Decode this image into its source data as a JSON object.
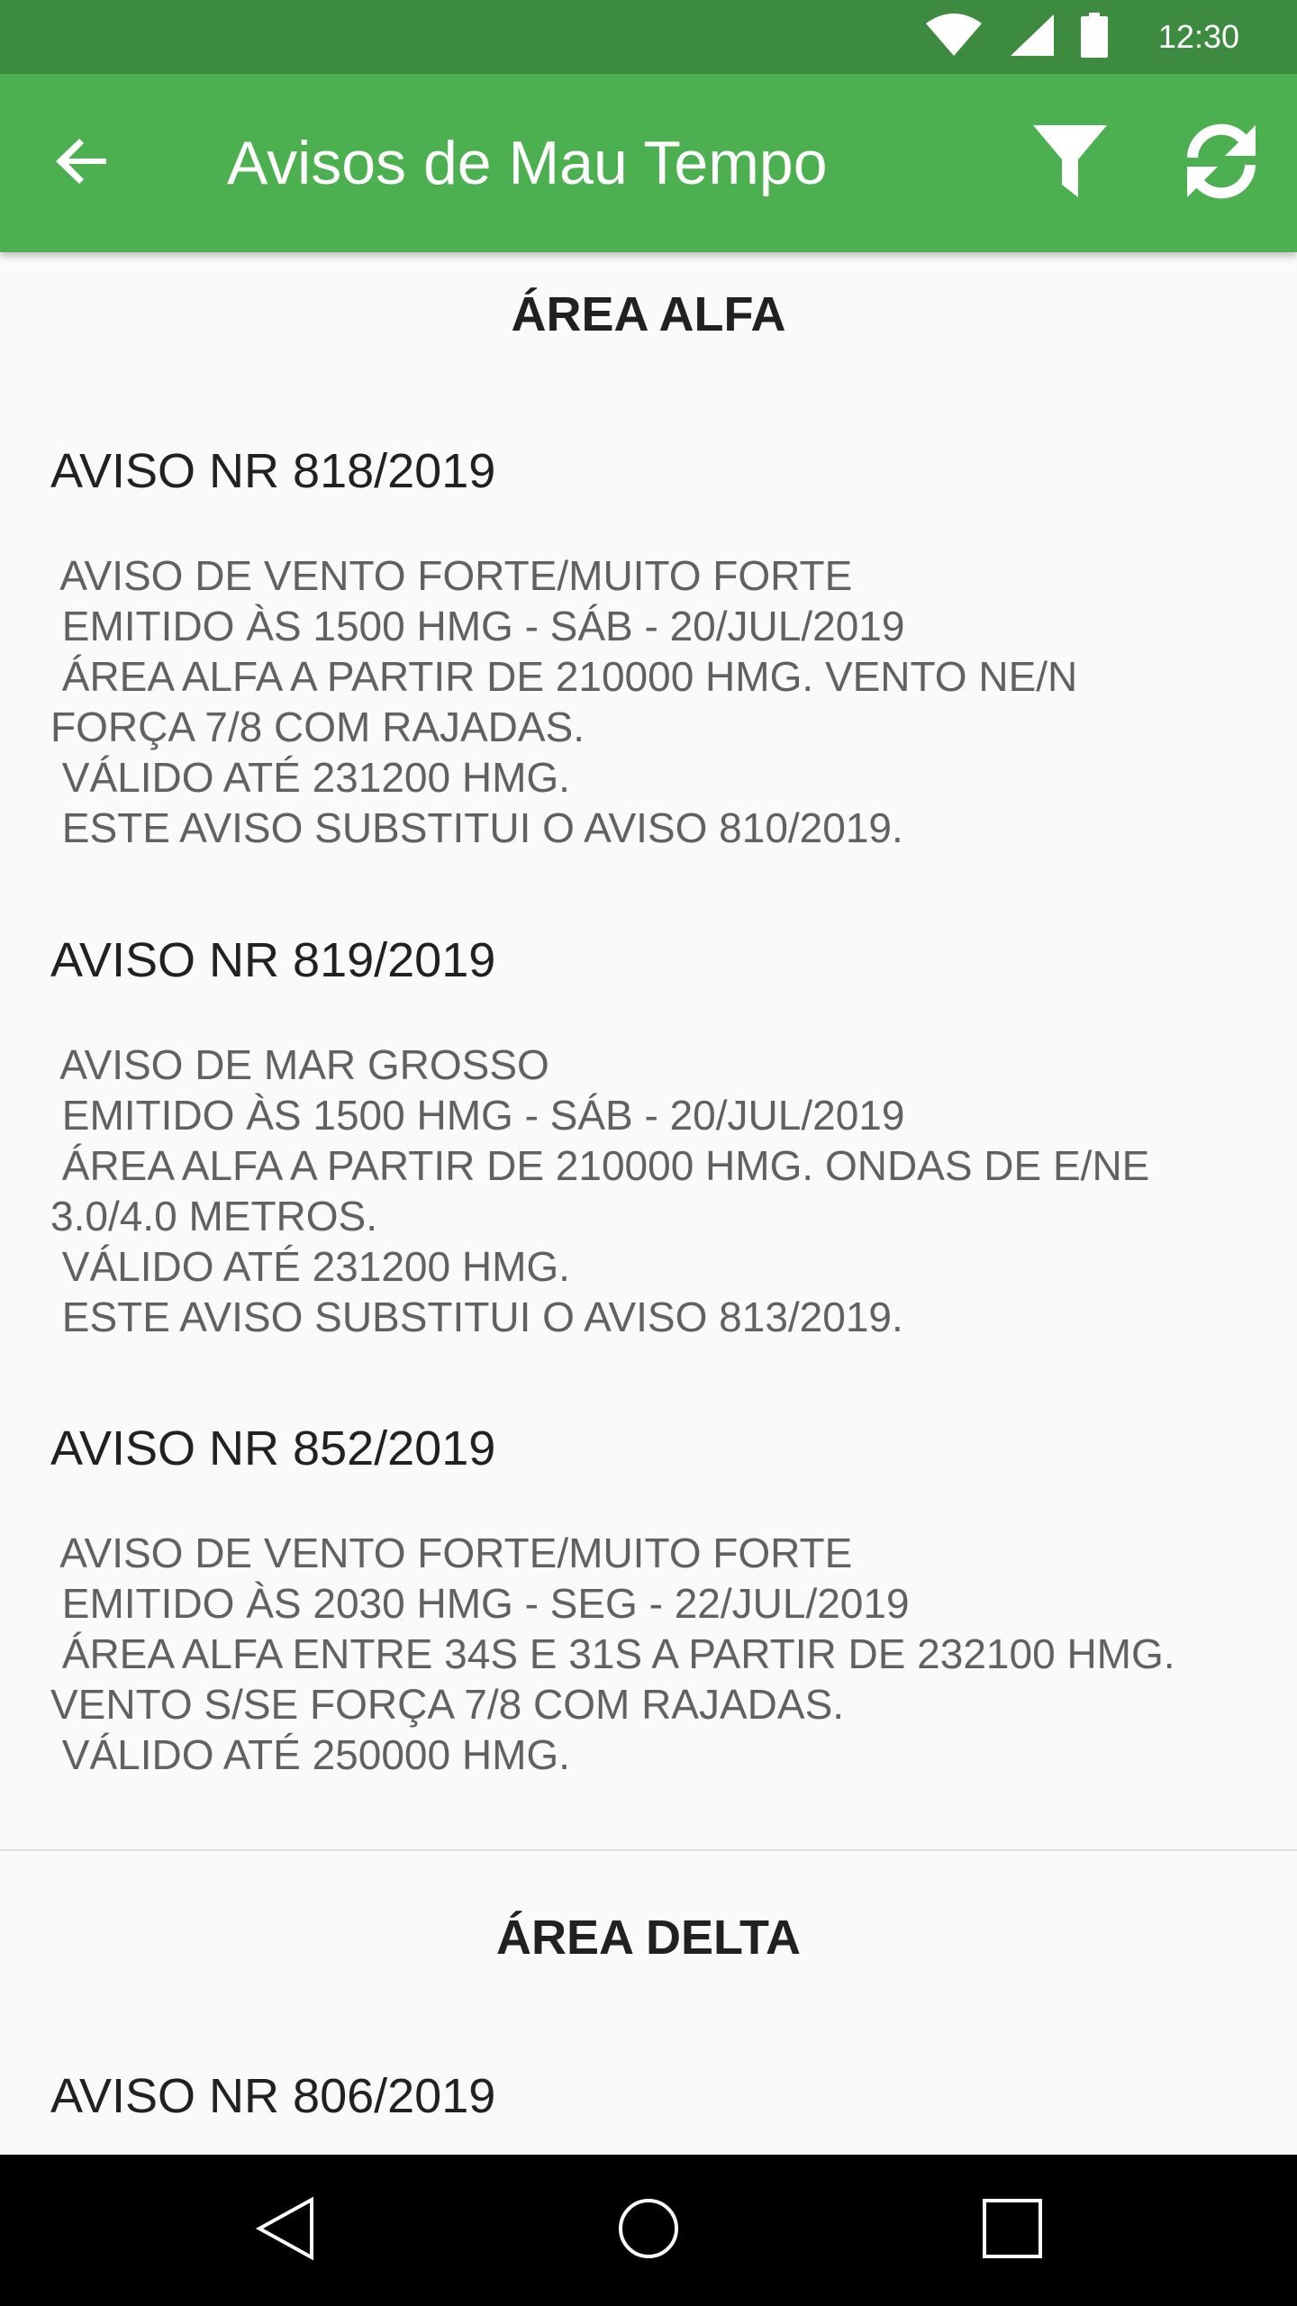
{
  "status_bar": {
    "time": "12:30",
    "icons": [
      "wifi-icon",
      "cell-signal-icon",
      "battery-icon"
    ]
  },
  "app_bar": {
    "title": "Avisos de Mau Tempo",
    "back_icon": "arrow-left-icon",
    "actions": [
      "filter-icon",
      "refresh-icon"
    ]
  },
  "areas": [
    {
      "name": "ÁREA ALFA",
      "warnings": [
        {
          "title": "AVISO NR 818/2019",
          "lines": [
            " AVISO DE VENTO FORTE/MUITO FORTE",
            " EMITIDO ÀS 1500 HMG - SÁB - 20/JUL/2019",
            " ÁREA ALFA A PARTIR DE 210000 HMG. VENTO NE/N",
            "FORÇA 7/8 COM RAJADAS.",
            " VÁLIDO ATÉ 231200 HMG.",
            " ESTE AVISO SUBSTITUI O AVISO 810/2019."
          ]
        },
        {
          "title": "AVISO NR 819/2019",
          "lines": [
            " AVISO DE MAR GROSSO",
            " EMITIDO ÀS 1500 HMG - SÁB - 20/JUL/2019",
            " ÁREA ALFA A PARTIR DE 210000 HMG. ONDAS DE E/NE",
            "3.0/4.0 METROS.",
            " VÁLIDO ATÉ 231200 HMG.",
            " ESTE AVISO SUBSTITUI O AVISO 813/2019."
          ]
        },
        {
          "title": "AVISO NR 852/2019",
          "lines": [
            " AVISO DE VENTO FORTE/MUITO FORTE",
            " EMITIDO ÀS 2030 HMG - SEG - 22/JUL/2019",
            " ÁREA ALFA ENTRE 34S E 31S A PARTIR DE 232100 HMG.",
            "VENTO S/SE FORÇA 7/8 COM RAJADAS.",
            " VÁLIDO ATÉ 250000 HMG."
          ]
        }
      ]
    },
    {
      "name": "ÁREA DELTA",
      "warnings": [
        {
          "title": "AVISO NR 806/2019",
          "lines": []
        }
      ]
    }
  ],
  "nav_bar": {
    "buttons": [
      "back-triangle-icon",
      "home-circle-icon",
      "recents-square-icon"
    ]
  },
  "colors": {
    "status_bar": "#3d8b40",
    "app_bar": "#4caf50",
    "background": "#fafafa",
    "title_text": "#212121",
    "body_text": "#616161"
  }
}
